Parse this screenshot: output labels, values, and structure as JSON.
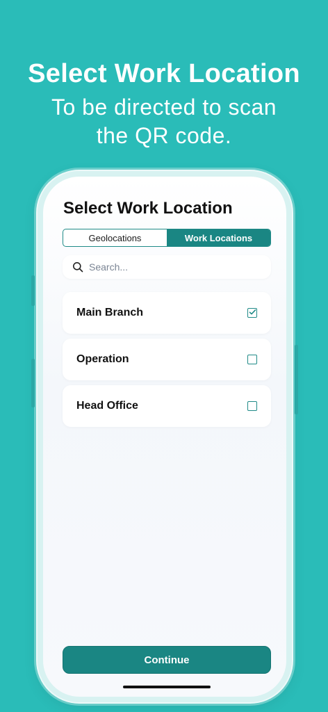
{
  "hero": {
    "title": "Select Work Location",
    "subtitle": "To be directed to scan the QR code."
  },
  "screen": {
    "title": "Select Work Location",
    "tabs": [
      {
        "label": "Geolocations",
        "active": false
      },
      {
        "label": "Work Locations",
        "active": true
      }
    ],
    "search": {
      "placeholder": "Search...",
      "value": ""
    },
    "locations": [
      {
        "label": "Main Branch",
        "checked": true
      },
      {
        "label": "Operation",
        "checked": false
      },
      {
        "label": "Head Office",
        "checked": false
      }
    ],
    "continue_label": "Continue"
  },
  "colors": {
    "background": "#2abcb8",
    "accent": "#1a8683"
  },
  "icons": {
    "search": "search-icon",
    "checked": "checkbox-checked-icon",
    "unchecked": "checkbox-empty-icon"
  }
}
